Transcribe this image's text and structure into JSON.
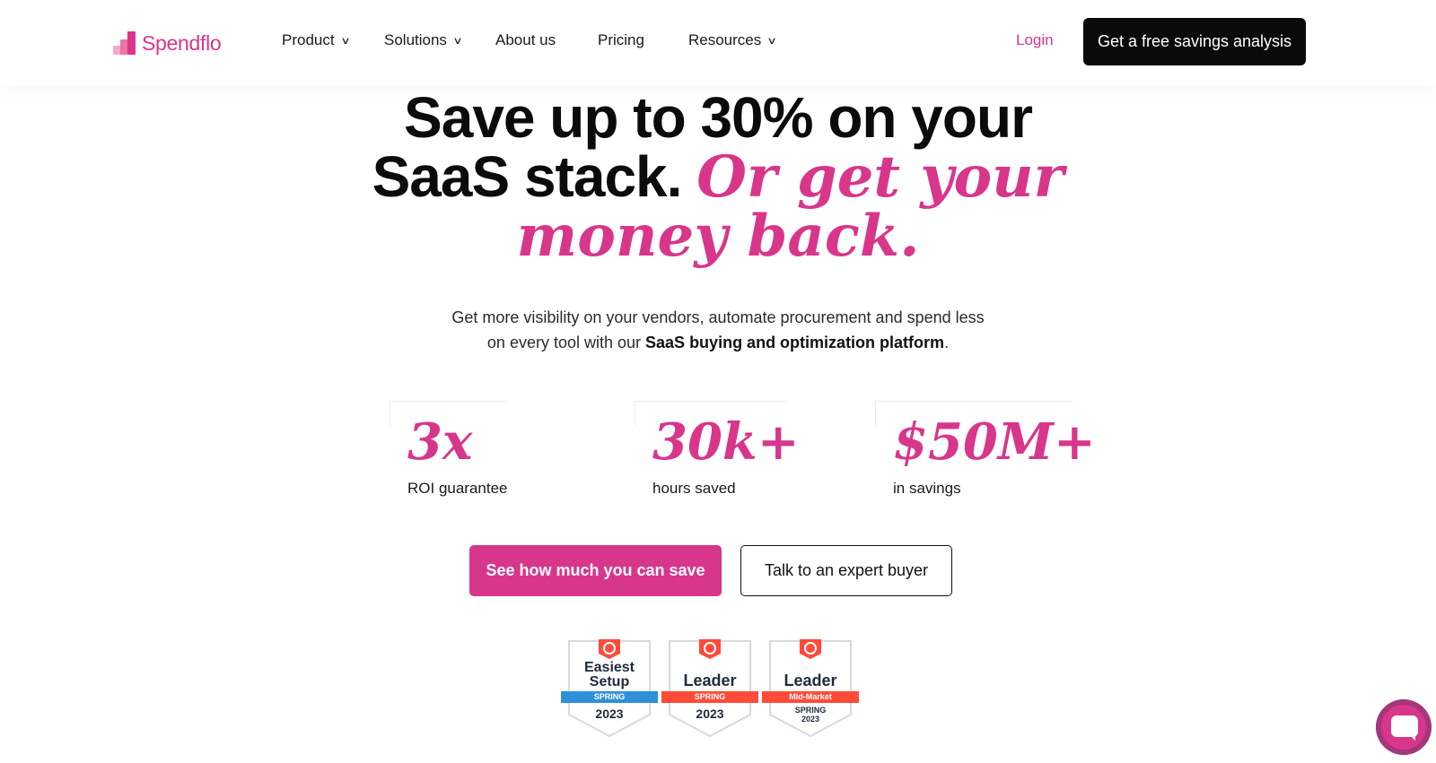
{
  "brand": {
    "name": "Spendflo",
    "accent_color": "#d8368b"
  },
  "nav": {
    "items": [
      {
        "label": "Product",
        "has_dropdown": true
      },
      {
        "label": "Solutions",
        "has_dropdown": true
      },
      {
        "label": "About us",
        "has_dropdown": false
      },
      {
        "label": "Pricing",
        "has_dropdown": false
      },
      {
        "label": "Resources",
        "has_dropdown": true
      }
    ],
    "login_label": "Login",
    "cta_label": "Get a free savings analysis"
  },
  "hero": {
    "headline_plain": "Save up to 30% on your SaaS stack.",
    "headline_line1": "Save up to 30% on your",
    "headline_line2_plain": "SaaS stack.",
    "headline_accent_a": "Or get your",
    "headline_accent_b": "money back.",
    "subtext_pre": "Get more visibility on your vendors, automate procurement and spend less on every tool with our",
    "subtext_line1": "Get more visibility on your vendors, automate procurement and spend less",
    "subtext_line2_pre": "on every tool with our",
    "subtext_bold": "SaaS buying and optimization platform",
    "subtext_post": "."
  },
  "stats": [
    {
      "value": "3x",
      "label": "ROI guarantee"
    },
    {
      "value": "30k+",
      "label": "hours saved"
    },
    {
      "value": "$50M+",
      "label": "in savings"
    }
  ],
  "buttons": {
    "primary_label": "See how much you can save",
    "secondary_label": "Talk to an expert buyer"
  },
  "badges": [
    {
      "title_line1": "Easiest",
      "title_line2": "Setup",
      "ribbon": "SPRING",
      "ribbon_color": "#2f8fd8",
      "year": "2023"
    },
    {
      "title_line1": "Leader",
      "title_line2": "",
      "ribbon": "SPRING",
      "ribbon_color": "#ff4b3a",
      "year": "2023"
    },
    {
      "title_line1": "Leader",
      "title_line2": "",
      "ribbon": "Mid-Market",
      "ribbon_color": "#ff4b3a",
      "season": "SPRING",
      "year": "2023"
    }
  ],
  "icons": {
    "chevron": "chevron-down-icon",
    "g2": "g2-logo-icon",
    "chat": "chat-bubble-icon"
  }
}
